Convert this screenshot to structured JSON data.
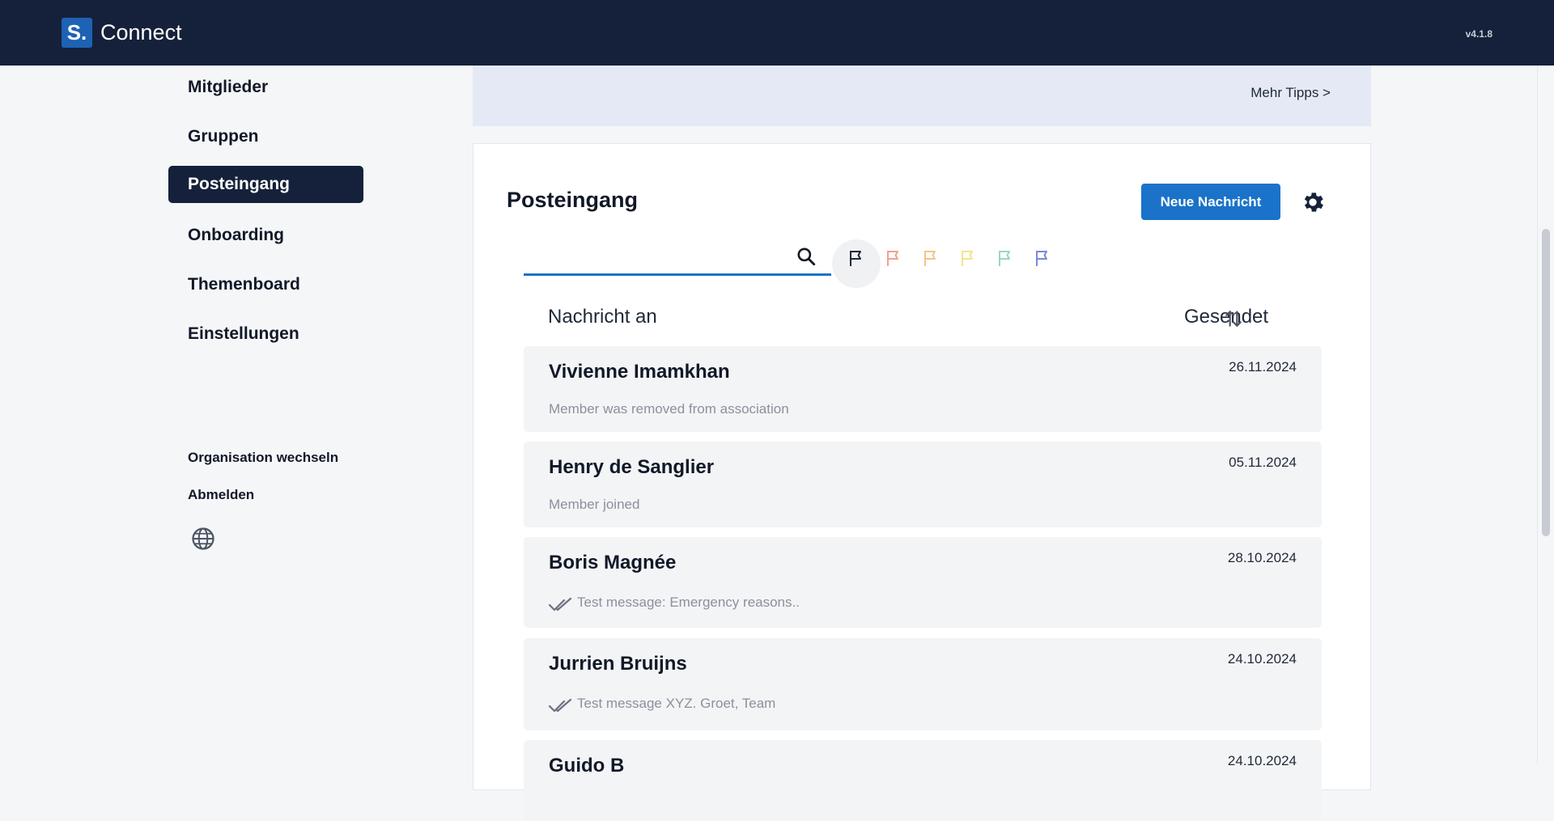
{
  "header": {
    "logo_mark": "S.",
    "app_name": "Connect",
    "version": "v4.1.8"
  },
  "sidebar": {
    "items": [
      {
        "label": "Mitglieder"
      },
      {
        "label": "Gruppen"
      },
      {
        "label": "Posteingang",
        "active": true
      },
      {
        "label": "Onboarding"
      },
      {
        "label": "Themenboard"
      },
      {
        "label": "Einstellungen"
      }
    ],
    "switch_org": "Organisation wechseln",
    "logout": "Abmelden",
    "language_icon": "globe-icon"
  },
  "tips": {
    "more_link": "Mehr Tipps >"
  },
  "inbox": {
    "title": "Posteingang",
    "new_message_button": "Neue Nachricht",
    "settings_icon": "gear-icon",
    "search": {
      "value": "",
      "icon": "search-icon"
    },
    "flags": [
      {
        "name": "all",
        "color": "#1f2937"
      },
      {
        "name": "red",
        "color": "#f4a08f"
      },
      {
        "name": "orange",
        "color": "#f6c58a"
      },
      {
        "name": "yellow",
        "color": "#f3e48c"
      },
      {
        "name": "green",
        "color": "#9ad8bb"
      },
      {
        "name": "blue",
        "color": "#7f84e0"
      }
    ],
    "columns": {
      "recipient": "Nachricht an",
      "sent": "Gesendet"
    },
    "messages": [
      {
        "name": "Vivienne Imamkhan",
        "date": "26.11.2024",
        "preview": "Member was removed from association",
        "read_icon": false
      },
      {
        "name": "Henry de Sanglier",
        "date": "05.11.2024",
        "preview": "Member joined",
        "read_icon": false
      },
      {
        "name": "Boris Magnée",
        "date": "28.10.2024",
        "preview": "Test message: Emergency reasons..",
        "read_icon": true
      },
      {
        "name": "Jurrien Bruijns",
        "date": "24.10.2024",
        "preview": "Test message XYZ. Groet, Team",
        "read_icon": true
      },
      {
        "name": "Guido B",
        "date": "24.10.2024",
        "preview": "",
        "read_icon": false
      }
    ]
  }
}
